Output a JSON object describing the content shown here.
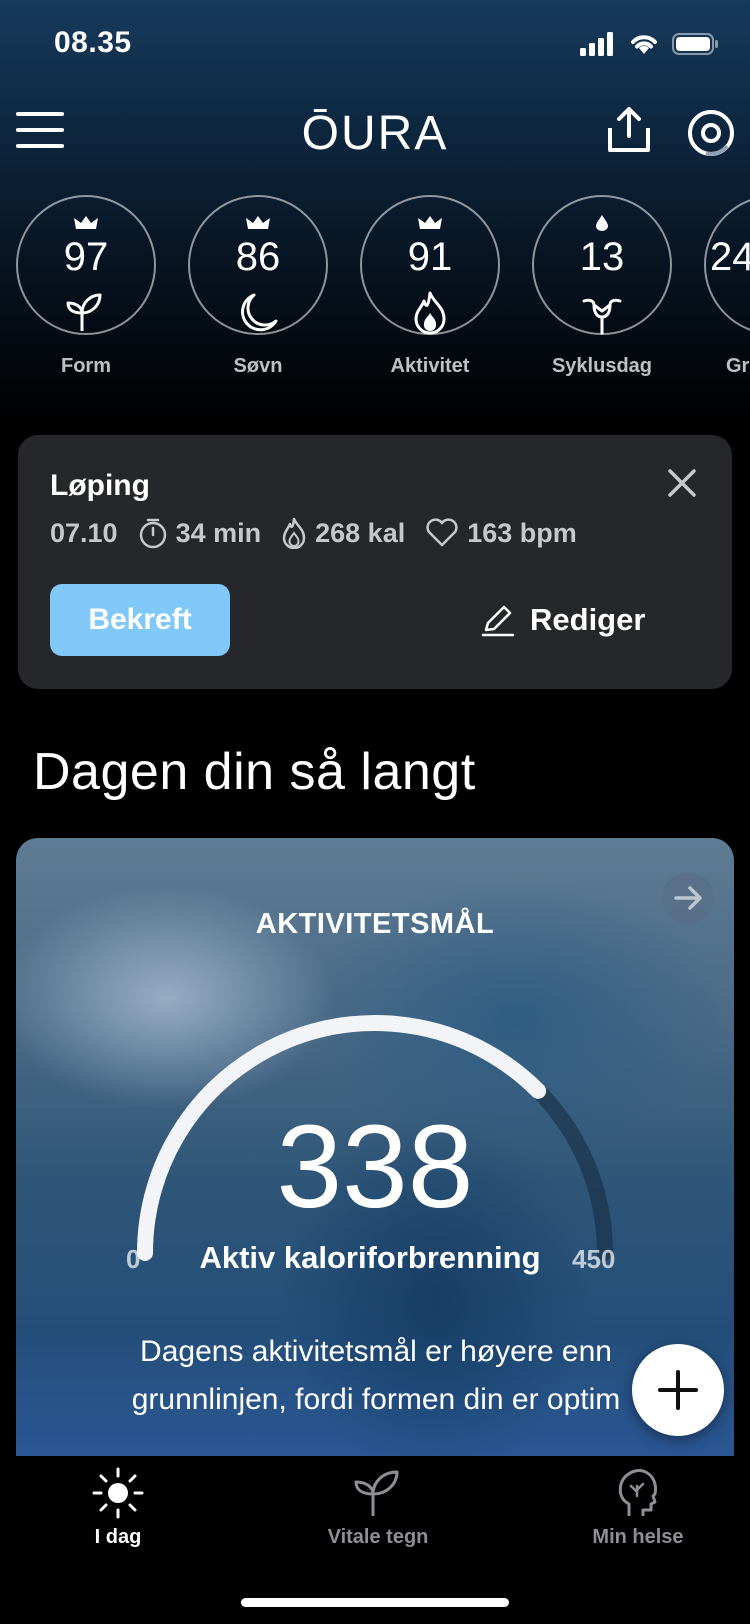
{
  "status": {
    "time": "08.35"
  },
  "header": {
    "logo": "ŌURA",
    "icons": [
      "menu-icon",
      "share-icon",
      "ring-icon"
    ]
  },
  "scores": [
    {
      "value": "97",
      "label": "Form",
      "top_icon": "crown-icon",
      "sub_icon": "sprout-icon"
    },
    {
      "value": "86",
      "label": "Søvn",
      "top_icon": "crown-icon",
      "sub_icon": "moon-icon"
    },
    {
      "value": "91",
      "label": "Aktivitet",
      "top_icon": "crown-icon",
      "sub_icon": "flame-icon"
    },
    {
      "value": "13",
      "label": "Syklusdag",
      "top_icon": "drop-icon",
      "sub_icon": "uterus-icon"
    },
    {
      "value": "24",
      "label": "Gr"
    }
  ],
  "workout": {
    "title": "Løping",
    "time": "07.10",
    "duration": "34 min",
    "calories": "268 kal",
    "heart_rate": "163 bpm",
    "confirm_label": "Bekreft",
    "edit_label": "Rediger",
    "confirm_color": "#7fc8f8"
  },
  "section": {
    "title": "Dagen din så langt"
  },
  "activity_card": {
    "label": "AKTIVITETSMÅL",
    "value": "338",
    "min": "0",
    "max": "450",
    "caption": "Aktiv kaloriforbrenning",
    "progress_fraction": 0.751,
    "description_line1": "Dagens aktivitetsmål er høyere enn",
    "description_line2": "grunnlinjen, fordi formen din er optim"
  },
  "bottom_nav": [
    {
      "label": "I dag",
      "icon": "sun-icon",
      "active": true
    },
    {
      "label": "Vitale tegn",
      "icon": "sprout-icon",
      "active": false
    },
    {
      "label": "Min helse",
      "icon": "head-icon",
      "active": false
    }
  ]
}
